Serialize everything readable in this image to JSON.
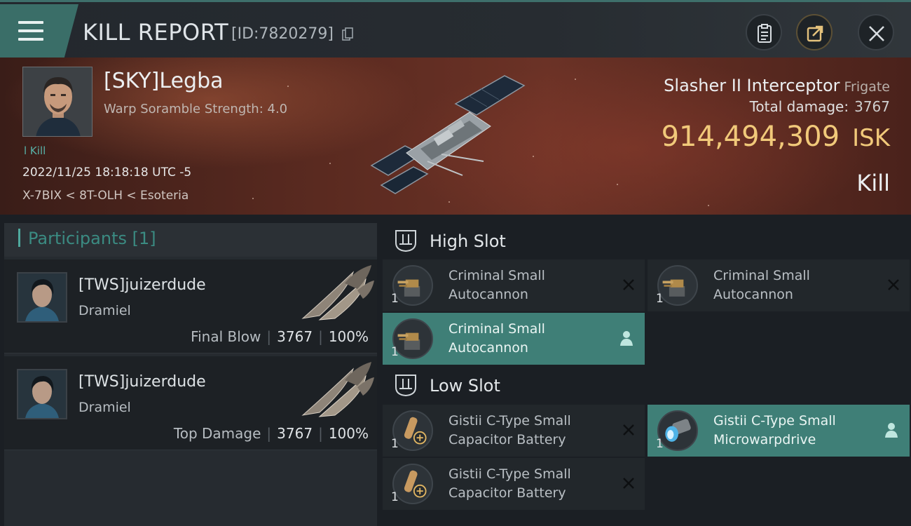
{
  "header": {
    "title": "KILL REPORT",
    "report_id": "[ID:7820279]"
  },
  "victim": {
    "name": "[SKY]Legba",
    "subtitle": "Warp Soramble Strength: 4.0",
    "tag": "l Kill",
    "datetime": "2022/11/25 18:18:18 UTC -5",
    "location": "X-7BIX < 8T-OLH < Esoteria"
  },
  "ship": {
    "name": "Slasher II Interceptor",
    "class": "Frigate",
    "total_damage_label": "Total damage:",
    "total_damage": "3767",
    "isk_value": "914,494,309",
    "isk_unit": "ISK",
    "outcome": "Kill"
  },
  "participants": {
    "title": "Participants [1]",
    "rows": [
      {
        "name": "[TWS]juizerdude",
        "ship": "Dramiel",
        "role": "Final Blow",
        "damage": "3767",
        "percent": "100%"
      },
      {
        "name": "[TWS]juizerdude",
        "ship": "Dramiel",
        "role": "Top Damage",
        "damage": "3767",
        "percent": "100%"
      }
    ]
  },
  "fitting": {
    "high_slot_title": "High Slot",
    "low_slot_title": "Low Slot",
    "high_slot": [
      {
        "line1": "Criminal Small",
        "line2": "Autocannon",
        "count": "1",
        "status": "destroyed"
      },
      {
        "line1": "Criminal Small",
        "line2": "Autocannon",
        "count": "1",
        "status": "destroyed"
      },
      {
        "line1": "Criminal Small",
        "line2": "Autocannon",
        "count": "1",
        "status": "dropped"
      }
    ],
    "low_slot": [
      {
        "line1": "Gistii C-Type Small",
        "line2": "Capacitor Battery",
        "count": "1",
        "status": "destroyed"
      },
      {
        "line1": "Gistii C-Type Small",
        "line2": "Microwarpdrive",
        "count": "1",
        "status": "dropped"
      },
      {
        "line1": "Gistii C-Type Small",
        "line2": "Capacitor Battery",
        "count": "1",
        "status": "destroyed"
      }
    ]
  },
  "icons": {
    "menu": "hamburger-icon",
    "report": "clipboard-icon",
    "share": "share-icon",
    "close": "close-icon",
    "destroyed": "x-icon",
    "dropped": "person-icon"
  },
  "colors": {
    "accent": "#3f7f77",
    "isk": "#f1c97a",
    "participants_title": "#3b8b82"
  }
}
